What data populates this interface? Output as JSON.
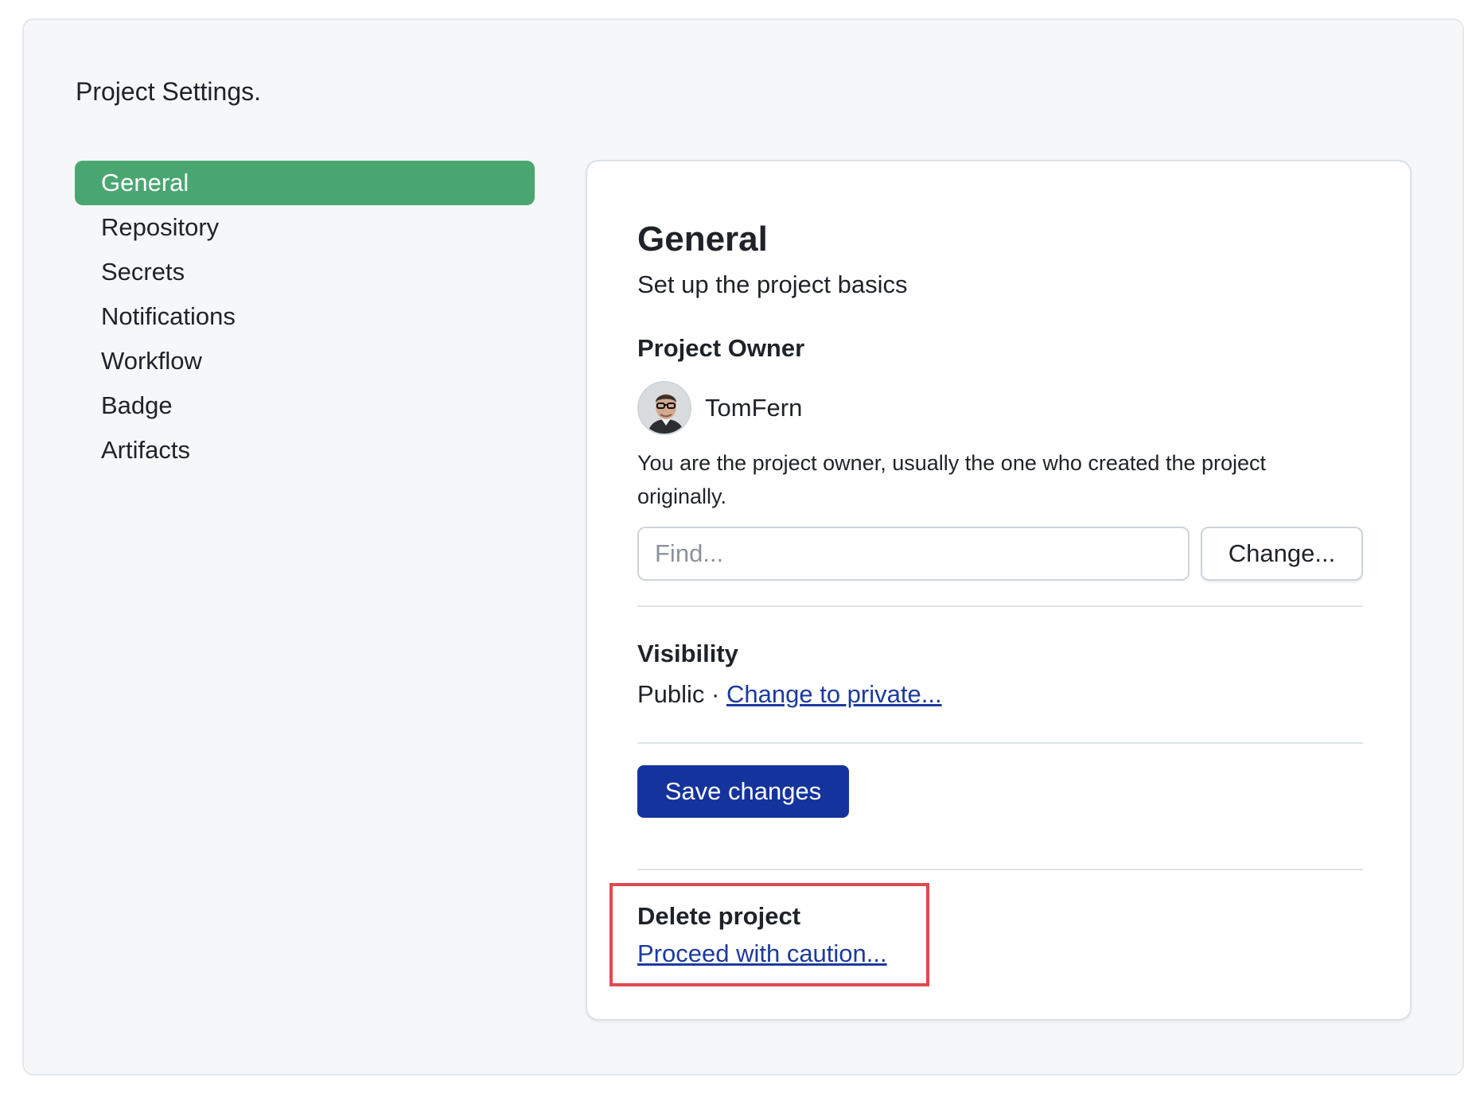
{
  "page": {
    "title": "Project Settings."
  },
  "sidebar": {
    "items": [
      {
        "label": "General",
        "active": true
      },
      {
        "label": "Repository",
        "active": false
      },
      {
        "label": "Secrets",
        "active": false
      },
      {
        "label": "Notifications",
        "active": false
      },
      {
        "label": "Workflow",
        "active": false
      },
      {
        "label": "Badge",
        "active": false
      },
      {
        "label": "Artifacts",
        "active": false
      }
    ]
  },
  "general": {
    "title": "General",
    "subtitle": "Set up the project basics",
    "owner": {
      "heading": "Project Owner",
      "name": "TomFern",
      "description": "You are the project owner, usually the one who created the project originally.",
      "find_placeholder": "Find...",
      "change_label": "Change..."
    },
    "visibility": {
      "heading": "Visibility",
      "current": "Public",
      "separator": " · ",
      "change_link": "Change to private..."
    },
    "save_label": "Save changes",
    "delete": {
      "heading": "Delete project",
      "link": "Proceed with caution..."
    }
  },
  "colors": {
    "active_nav": "#4aa671",
    "primary_button": "#14339c",
    "link": "#1c3a9e",
    "highlight_border": "#de4a4f",
    "frame_background": "#f5f7f9"
  },
  "icons": {
    "avatar": "user-avatar-photo"
  }
}
